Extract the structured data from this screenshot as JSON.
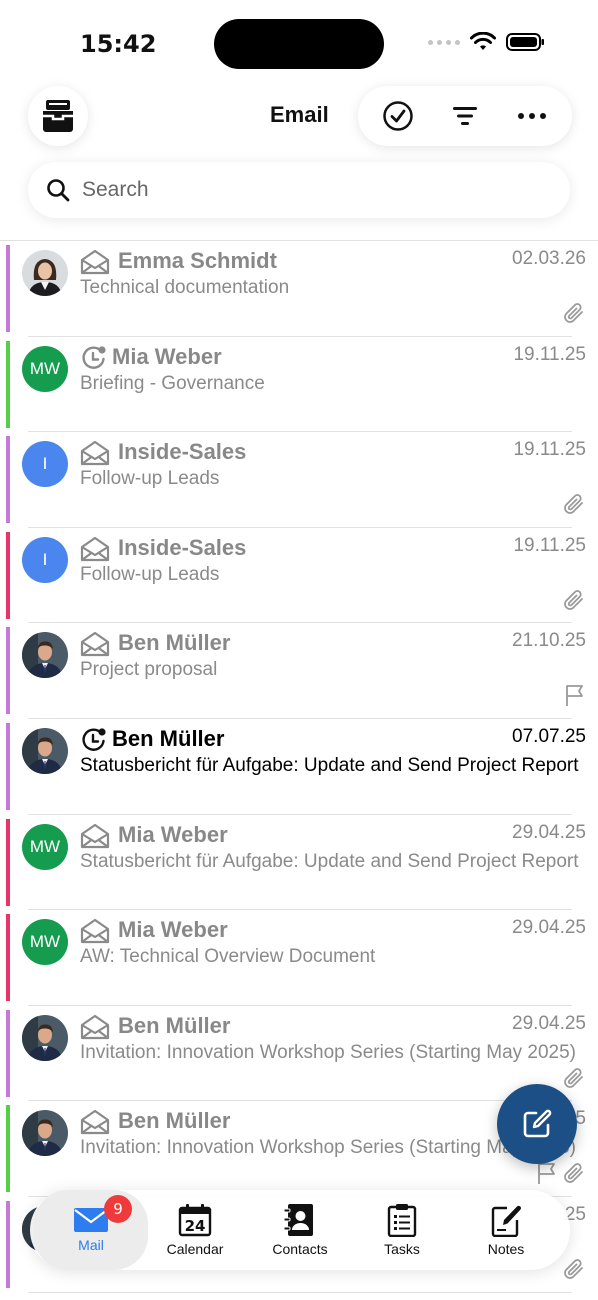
{
  "status_bar": {
    "time": "15:42"
  },
  "header": {
    "title": "Email"
  },
  "search": {
    "placeholder": "Search"
  },
  "colors": {
    "purple": "#c57ad9",
    "green": "#55d046",
    "pink": "#e8336b",
    "blue_avatar": "#4b86ef",
    "green_avatar": "#169c4e",
    "accent": "#2d7cf0",
    "fab": "#1c4f86"
  },
  "emails": [
    {
      "sender": "Emma Schmidt",
      "date": "02.03.26",
      "subject": "Technical documentation",
      "icon": "envelope-open-icon",
      "avatar": "photo-woman",
      "bar": "purple",
      "attachment": true,
      "flag": false,
      "unread": false
    },
    {
      "sender": "Mia Weber",
      "initials": "MW",
      "date": "19.11.25",
      "subject": "Briefing - Governance",
      "icon": "clock-icon",
      "avatar": "green",
      "bar": "green",
      "attachment": false,
      "flag": false,
      "unread": false
    },
    {
      "sender": "Inside-Sales",
      "initials": "I",
      "date": "19.11.25",
      "subject": "Follow-up Leads",
      "icon": "envelope-open-icon",
      "avatar": "blue",
      "bar": "purple",
      "attachment": true,
      "flag": false,
      "unread": false
    },
    {
      "sender": "Inside-Sales",
      "initials": "I",
      "date": "19.11.25",
      "subject": "Follow-up Leads",
      "icon": "envelope-open-icon",
      "avatar": "blue",
      "bar": "pink",
      "attachment": true,
      "flag": false,
      "unread": false
    },
    {
      "sender": "Ben Müller",
      "date": "21.10.25",
      "subject": "Project proposal",
      "icon": "envelope-open-icon",
      "avatar": "photo-man",
      "bar": "purple",
      "attachment": false,
      "flag": true,
      "unread": false
    },
    {
      "sender": "Ben Müller",
      "date": "07.07.25",
      "subject": "Statusbericht für Aufgabe: Update and Send Project Report",
      "icon": "clock-icon",
      "avatar": "photo-man",
      "bar": "purple",
      "attachment": false,
      "flag": false,
      "unread": true
    },
    {
      "sender": "Mia Weber",
      "initials": "MW",
      "date": "29.04.25",
      "subject": "Statusbericht für Aufgabe: Update and Send Project Report",
      "icon": "envelope-open-icon",
      "avatar": "green",
      "bar": "pink",
      "attachment": false,
      "flag": false,
      "unread": false
    },
    {
      "sender": "Mia Weber",
      "initials": "MW",
      "date": "29.04.25",
      "subject": "AW: Technical Overview Document",
      "icon": "envelope-open-icon",
      "avatar": "green",
      "bar": "pink",
      "attachment": false,
      "flag": false,
      "unread": false
    },
    {
      "sender": "Ben Müller",
      "date": "29.04.25",
      "subject": "Invitation: Innovation Workshop Series (Starting May 2025)",
      "icon": "envelope-open-icon",
      "avatar": "photo-man",
      "bar": "purple",
      "attachment": true,
      "flag": false,
      "unread": false
    },
    {
      "sender": "Ben Müller",
      "date": "29.04.25",
      "subject": "Invitation: Innovation Workshop Series (Starting May 2025)",
      "icon": "envelope-open-icon",
      "avatar": "photo-man",
      "bar": "green",
      "attachment": true,
      "flag": true,
      "unread": false
    },
    {
      "sender": "",
      "date": "25",
      "subject": "",
      "icon": "envelope-open-icon",
      "avatar": "photo-man",
      "bar": "purple",
      "attachment": true,
      "flag": false,
      "unread": false
    }
  ],
  "tabs": [
    {
      "label": "Mail",
      "icon": "mail-icon",
      "active": true,
      "badge": "9"
    },
    {
      "label": "Calendar",
      "icon": "calendar-icon",
      "active": false,
      "day": "24"
    },
    {
      "label": "Contacts",
      "icon": "contacts-icon",
      "active": false
    },
    {
      "label": "Tasks",
      "icon": "tasks-icon",
      "active": false
    },
    {
      "label": "Notes",
      "icon": "notes-icon",
      "active": false
    }
  ]
}
